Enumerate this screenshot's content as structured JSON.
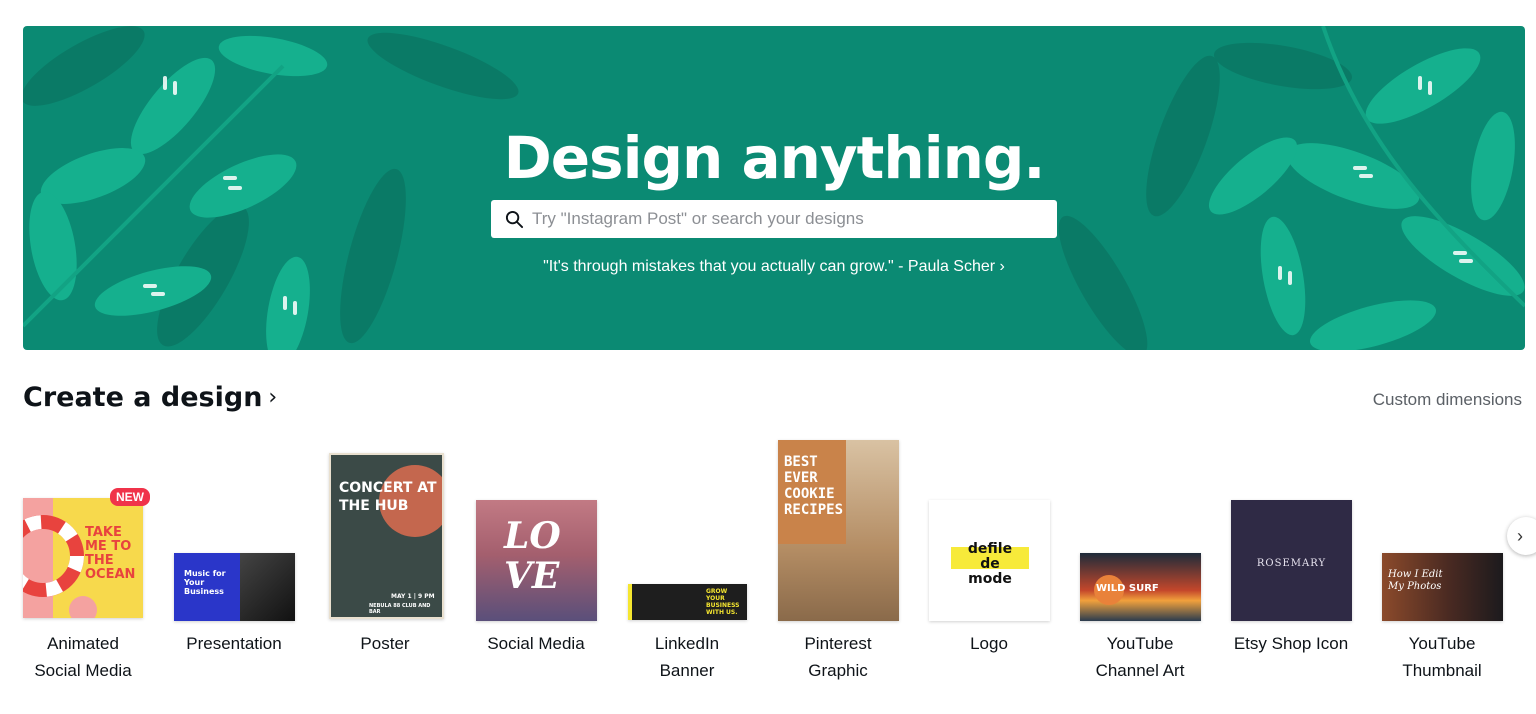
{
  "hero": {
    "title": "Design anything.",
    "search_placeholder": "Try \"Instagram Post\" or search your designs",
    "quote": "\"It's through mistakes that you actually can grow.\" - Paula Scher ›",
    "bg_color": "#0b8a73",
    "leaf_color": "#13b38f"
  },
  "create": {
    "title": "Create a design",
    "chevron": "›",
    "custom_dimensions": "Custom dimensions",
    "next_icon": "chevron-right-icon"
  },
  "tiles": [
    {
      "label_line1": "Animated",
      "label_line2": "Social Media",
      "badge": "NEW",
      "thumb_text": "TAKE ME TO THE OCEAN"
    },
    {
      "label_line1": "Presentation",
      "label_line2": "",
      "thumb_text": "Music for Your Business"
    },
    {
      "label_line1": "Poster",
      "label_line2": "",
      "thumb_text": "CONCERT AT THE HUB",
      "thumb_sub": "MAY 1 | 9 PM",
      "thumb_sub2": "NEBULA 88 CLUB AND BAR"
    },
    {
      "label_line1": "Social Media",
      "label_line2": "",
      "thumb_text": "LOVE"
    },
    {
      "label_line1": "LinkedIn",
      "label_line2": "Banner",
      "thumb_text": "GROW YOUR BUSINESS WITH US."
    },
    {
      "label_line1": "Pinterest",
      "label_line2": "Graphic",
      "thumb_text": "BEST EVER COOKIE RECIPES"
    },
    {
      "label_line1": "Logo",
      "label_line2": "",
      "thumb_text": "defile de mode"
    },
    {
      "label_line1": "YouTube",
      "label_line2": "Channel Art",
      "thumb_text": "WILD SURF"
    },
    {
      "label_line1": "Etsy Shop Icon",
      "label_line2": "",
      "thumb_text": "ROSEMARY"
    },
    {
      "label_line1": "YouTube",
      "label_line2": "Thumbnail",
      "thumb_text": "How I Edit My Photos"
    }
  ]
}
